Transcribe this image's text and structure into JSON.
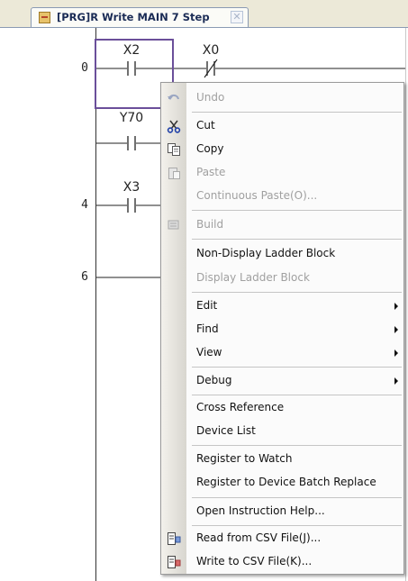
{
  "tab": {
    "title": "[PRG]R Write MAIN 7 Step",
    "close_glyph": "✕"
  },
  "ladder": {
    "step_numbers": [
      "0",
      "4",
      "6"
    ],
    "contacts": [
      "X2",
      "X0",
      "Y70",
      "X3"
    ]
  },
  "menu": {
    "items": [
      {
        "label": "Undo",
        "disabled": true,
        "icon": "undo-icon"
      },
      {
        "label": "Cut",
        "disabled": false,
        "icon": "scissors-icon"
      },
      {
        "label": "Copy",
        "disabled": false,
        "icon": "copy-icon"
      },
      {
        "label": "Paste",
        "disabled": true,
        "icon": "paste-icon"
      },
      {
        "label": "Continuous Paste(O)...",
        "disabled": true
      },
      {
        "label": "Build",
        "disabled": true,
        "icon": "build-icon"
      },
      {
        "label": "Non-Display Ladder Block",
        "disabled": false
      },
      {
        "label": "Display Ladder Block",
        "disabled": true
      },
      {
        "label": "Edit",
        "disabled": false,
        "submenu": true
      },
      {
        "label": "Find",
        "disabled": false,
        "submenu": true
      },
      {
        "label": "View",
        "disabled": false,
        "submenu": true
      },
      {
        "label": "Debug",
        "disabled": false,
        "submenu": true
      },
      {
        "label": "Cross Reference",
        "disabled": false
      },
      {
        "label": "Device List",
        "disabled": false
      },
      {
        "label": "Register to Watch",
        "disabled": false
      },
      {
        "label": "Register to Device Batch Replace",
        "disabled": false
      },
      {
        "label": "Open Instruction Help...",
        "disabled": false
      },
      {
        "label": "Read from CSV File(J)...",
        "disabled": false,
        "icon": "csv-read-icon"
      },
      {
        "label": "Write to CSV File(K)...",
        "disabled": false,
        "icon": "csv-write-icon"
      }
    ]
  }
}
